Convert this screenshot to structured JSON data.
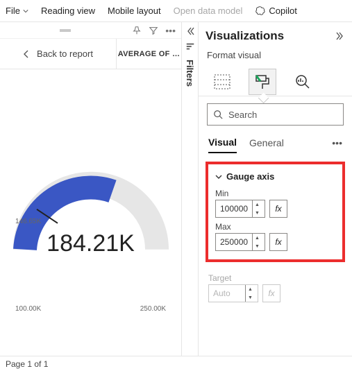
{
  "ribbon": {
    "file": "File",
    "reading_view": "Reading view",
    "mobile_layout": "Mobile layout",
    "open_data_model": "Open data model",
    "copilot": "Copilot"
  },
  "canvas": {
    "back_label": "Back to report",
    "avg_title": "AVERAGE OF …",
    "gauge_value": "184.21K",
    "min_label": "100.00K",
    "max_label": "250.00K",
    "target_label": "146.65K"
  },
  "chart_data": {
    "type": "gauge",
    "title": "AVERAGE OF …",
    "value": 184210,
    "value_display": "184.21K",
    "min": 100000,
    "max": 250000,
    "target": 146650,
    "unit": "K"
  },
  "filters": {
    "label": "Filters"
  },
  "viz": {
    "pane_title": "Visualizations",
    "format_visual": "Format visual",
    "search_placeholder": "Search",
    "tab_visual": "Visual",
    "tab_general": "General"
  },
  "gauge_axis": {
    "title": "Gauge axis",
    "min_label": "Min",
    "min_value": "100000",
    "max_label": "Max",
    "max_value": "250000",
    "target_label": "Target",
    "target_value": "Auto",
    "fx": "fx"
  },
  "footer": {
    "page": "Page 1 of 1"
  }
}
